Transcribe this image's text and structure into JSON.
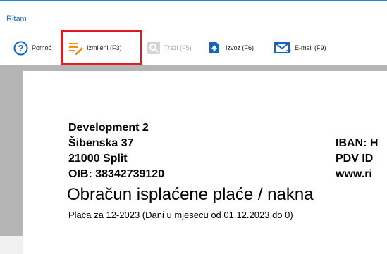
{
  "window": {
    "title": "Ritam"
  },
  "toolbar": {
    "help": {
      "label_hot": "P",
      "label_rest": "omoć",
      "icon": "help-circle-icon"
    },
    "edit": {
      "label_hot": "I",
      "label_rest": "zmijeni (F3)",
      "icon": "edit-pencil-icon",
      "highlighted": true
    },
    "search": {
      "label_hot": "T",
      "label_rest": "raži (F5)",
      "icon": "magnifier-icon",
      "disabled": true
    },
    "export": {
      "label_hot": "I",
      "label_rest": "zvoz (F6)",
      "icon": "export-arrow-icon"
    },
    "email": {
      "label": "E-mail (F9)",
      "icon": "envelope-icon"
    }
  },
  "colors": {
    "accent": "#1e88e5",
    "highlight": "#e21b23",
    "edit_icon": "#f39200"
  },
  "document": {
    "company_name": "Development  2",
    "street": "Šibenska 37",
    "city": "21000 Split",
    "oib": "OIB: 38342739120",
    "iban": "IBAN: H",
    "pdv": "PDV ID",
    "web": "www.ri",
    "heading": "Obračun isplaćene plaće / nakna",
    "subheading": "Plaća za 12-2023  (Dani u mjesecu od 01.12.2023 do 0)"
  }
}
